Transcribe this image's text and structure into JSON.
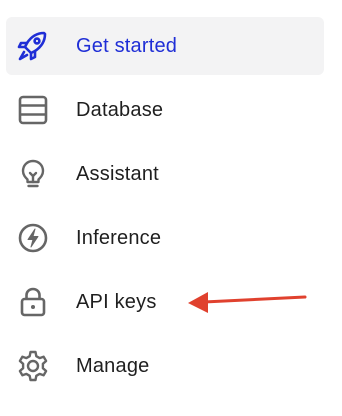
{
  "sidebar": {
    "items": [
      {
        "label": "Get started",
        "icon": "rocket-icon",
        "active": true
      },
      {
        "label": "Database",
        "icon": "database-icon",
        "active": false
      },
      {
        "label": "Assistant",
        "icon": "lightbulb-icon",
        "active": false
      },
      {
        "label": "Inference",
        "icon": "lightning-icon",
        "active": false
      },
      {
        "label": "API keys",
        "icon": "lock-icon",
        "active": false
      },
      {
        "label": "Manage",
        "icon": "gear-icon",
        "active": false
      }
    ]
  },
  "colors": {
    "active_text": "#1f2ed6",
    "active_background": "#f3f3f4",
    "icon_gray": "#6b6b6b",
    "annotation_arrow": "#e0412e"
  }
}
